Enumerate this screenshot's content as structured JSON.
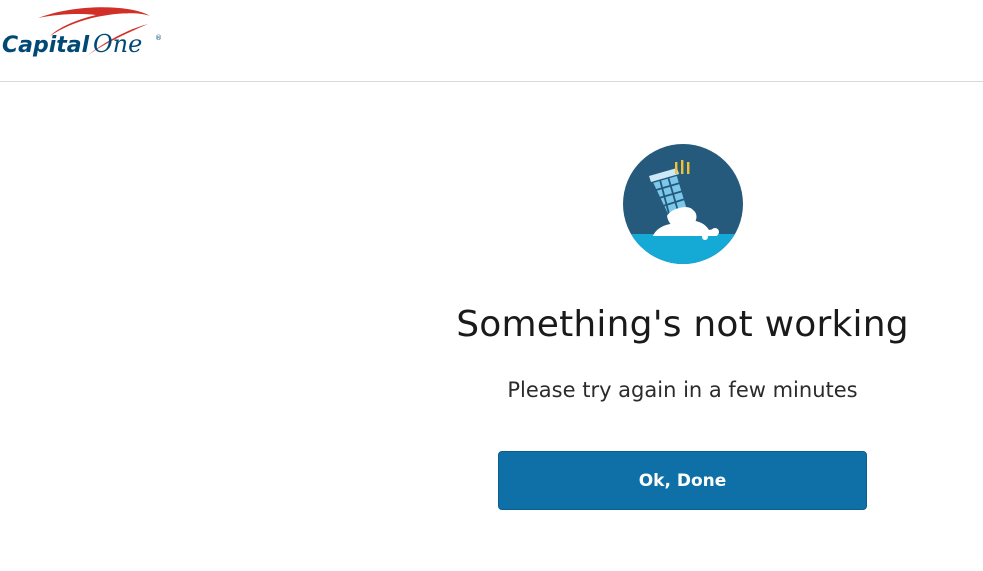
{
  "header": {
    "logo_text": "Capital One",
    "brand_colors": {
      "navy": "#004977",
      "red": "#d03027"
    }
  },
  "error": {
    "illustration_icon": "spilled-ice-cream-icon",
    "title": "Something's not working",
    "message": "Please try again in a few minutes",
    "button_label": "Ok, Done",
    "button_color": "#0f70a8"
  }
}
